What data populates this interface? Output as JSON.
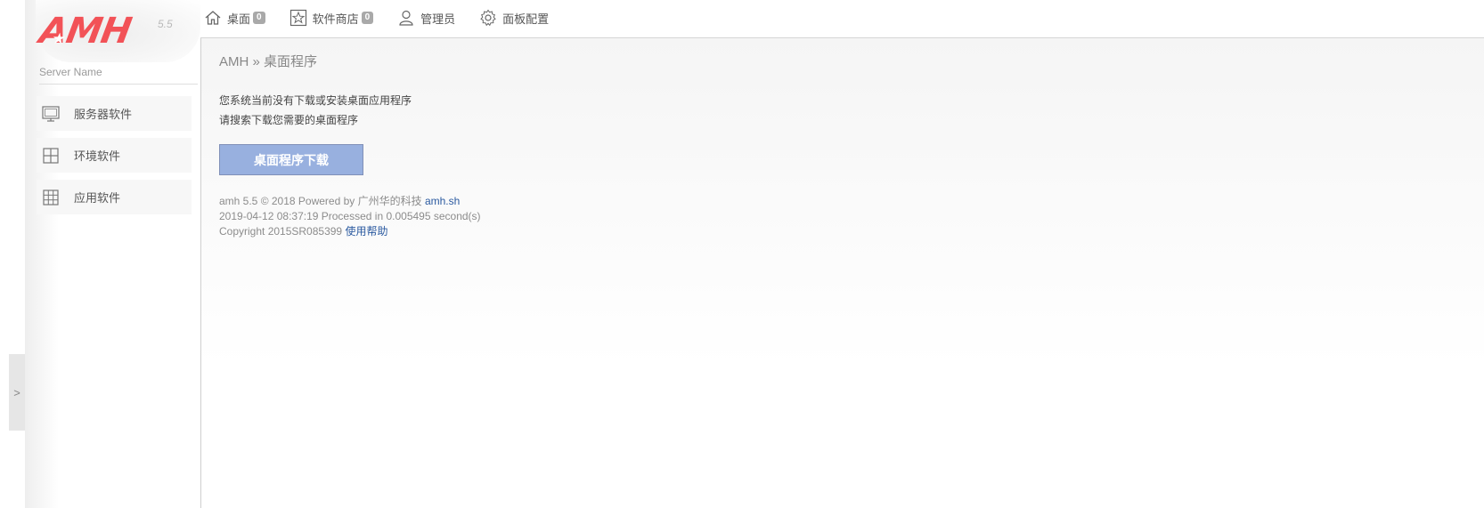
{
  "sidebar": {
    "logo_text": "AMH",
    "version": "5.5",
    "server_name": "Server Name",
    "items": [
      {
        "label": "服务器软件",
        "icon": "monitor-icon"
      },
      {
        "label": "环境软件",
        "icon": "window-grid-icon"
      },
      {
        "label": "应用软件",
        "icon": "grid-icon"
      }
    ],
    "collapse_label": ">"
  },
  "topnav": {
    "items": [
      {
        "label": "桌面",
        "badge": "0",
        "icon": "home-icon"
      },
      {
        "label": "软件商店",
        "badge": "0",
        "icon": "star-icon"
      },
      {
        "label": "管理员",
        "icon": "user-icon"
      },
      {
        "label": "面板配置",
        "icon": "gear-icon"
      }
    ]
  },
  "main": {
    "breadcrumb": "AMH » 桌面程序",
    "message_line1": "您系统当前没有下载或安装桌面应用程序",
    "message_line2": "请搜索下载您需要的桌面程序",
    "download_button": "桌面程序下载"
  },
  "footer": {
    "line1_text": "amh 5.5 © 2018 Powered by 广州华的科技",
    "line1_link": "amh.sh",
    "line2": "2019-04-12 08:37:19 Processed in 0.005495 second(s)",
    "line3_text": "Copyright 2015SR085399",
    "line3_link": "使用帮助"
  },
  "colors": {
    "logo": "#f25257",
    "button": "#98b0df",
    "link": "#2b5aa0"
  }
}
